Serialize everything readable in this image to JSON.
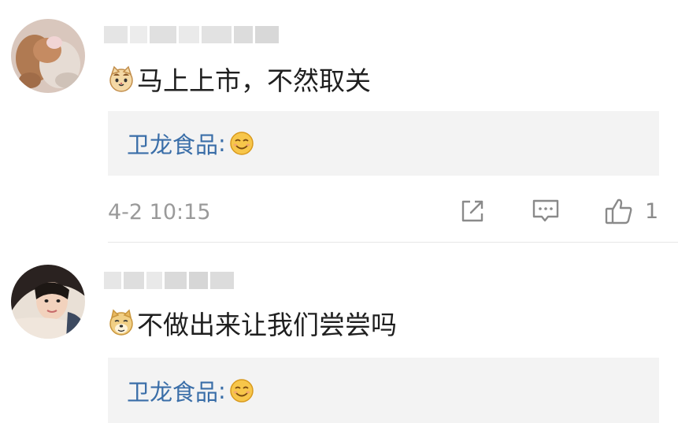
{
  "comments": [
    {
      "username": "",
      "text": "马上上市，不然取关",
      "emoji": "cat-face-icon",
      "reply": {
        "author": "卫龙食品",
        "colon": ":",
        "emoji": "smile-icon"
      },
      "timestamp": "4-2 10:15",
      "likes": "1"
    },
    {
      "username": "",
      "text": "不做出来让我们尝尝吗",
      "emoji": "doge-face-icon",
      "reply": {
        "author": "卫龙食品",
        "colon": ":",
        "emoji": "smile-icon"
      }
    }
  ],
  "colors": {
    "reply_author": "#3a6ea8",
    "reply_bg": "#f3f3f3",
    "meta_text": "#9a9a9a",
    "icon": "#8a8a8a"
  }
}
